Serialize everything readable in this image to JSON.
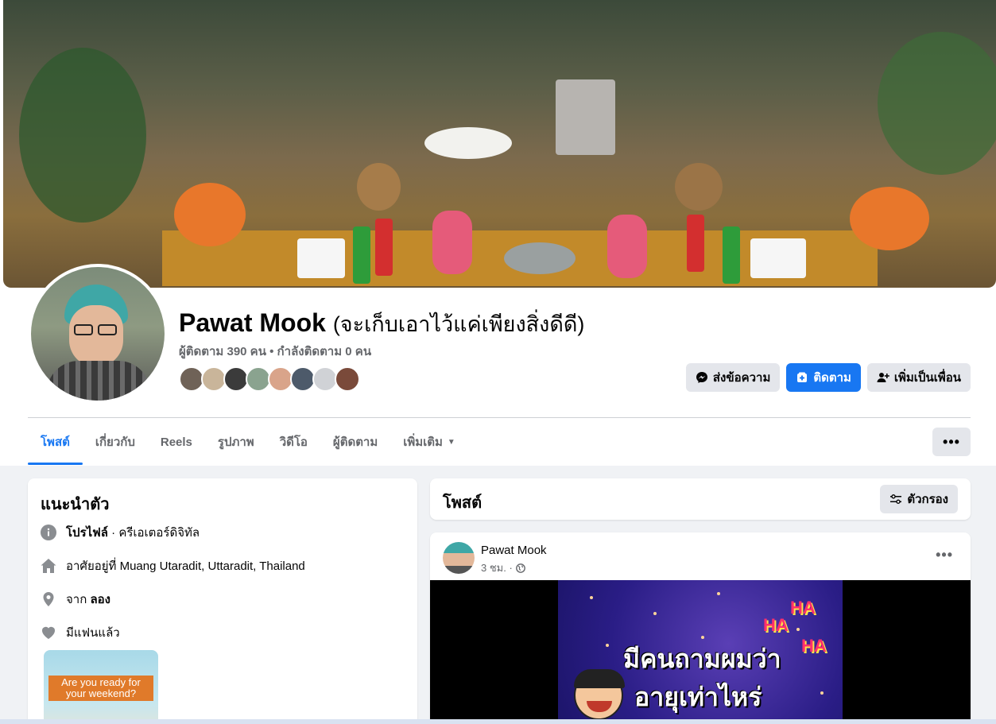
{
  "profile": {
    "name": "Pawat Mook",
    "alternate_name": "(จะเก็บเอาไว้แค่เพียงสิ่งดีดี)",
    "followers_text": "ผู้ติดตาม 390 คน • กำลังติดตาม 0 คน",
    "friend_avatar_colors": [
      "#6f6257",
      "#c9b59a",
      "#3b3b3b",
      "#8aa38f",
      "#d9a48a",
      "#4d5a6a",
      "#d0d2d6",
      "#7a4a3a"
    ]
  },
  "actions": {
    "message_label": "ส่งข้อความ",
    "follow_label": "ติดตาม",
    "add_friend_label": "เพิ่มเป็นเพื่อน"
  },
  "tabs": [
    {
      "label": "โพสต์",
      "active": true
    },
    {
      "label": "เกี่ยวกับ"
    },
    {
      "label": "Reels"
    },
    {
      "label": "รูปภาพ"
    },
    {
      "label": "วิดีโอ"
    },
    {
      "label": "ผู้ติดตาม"
    },
    {
      "label": "เพิ่มเติม"
    }
  ],
  "more_menu_label": "•••",
  "intro": {
    "title": "แนะนำตัว",
    "profile_label": "โปรไฟล์",
    "profile_category": " · ครีเอเตอร์ดิจิทัล",
    "lives_in": "อาศัยอยู่ที่ Muang Utaradit, Uttaradit, Thailand",
    "from_prefix": "จาก ",
    "from_place": "ลอง",
    "relationship": "มีแฟนแล้ว",
    "featured_photo_text": "Are you ready for your weekend?"
  },
  "posts_header": {
    "title": "โพสต์",
    "filter_label": "ตัวกรอง"
  },
  "post": {
    "author": "Pawat Mook",
    "time": "3 ชม. ·",
    "more_label": "•••",
    "video_line1": "มีคนถามผมว่า",
    "video_line2": "อายุเท่าไหร่",
    "video_ha": "HA"
  },
  "colors": {
    "accent": "#1877f2",
    "background": "#f0f2f5",
    "secondary_text": "#65676b"
  }
}
